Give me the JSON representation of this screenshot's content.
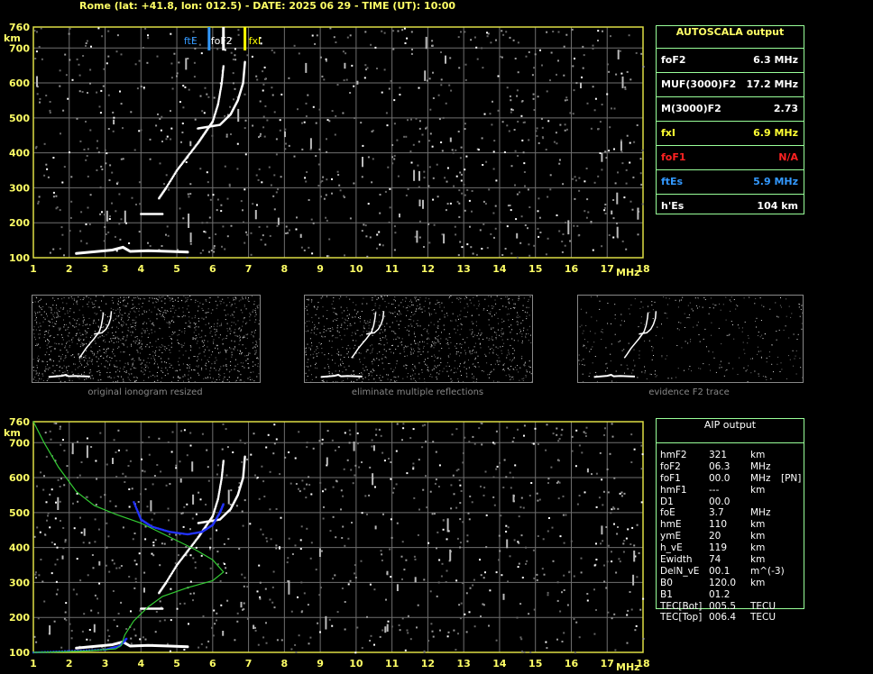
{
  "header": "Rome (lat: +41.8, lon: 012.5) - DATE: 2025 06 29 - TIME (UT): 10:00",
  "chart_data": [
    {
      "type": "scatter",
      "name": "ionogram-autoscala",
      "x_ticks": [
        "1",
        "2",
        "3",
        "4",
        "5",
        "6",
        "7",
        "8",
        "9",
        "10",
        "11",
        "12",
        "13",
        "14",
        "15",
        "16",
        "17",
        "18"
      ],
      "y_ticks": [
        "760",
        "700",
        "600",
        "500",
        "400",
        "300",
        "200",
        "100"
      ],
      "xlabel": "MHz",
      "ylabel": "km",
      "xlim": [
        1,
        18
      ],
      "ylim": [
        100,
        760
      ],
      "markers": [
        {
          "label": "ftE",
          "x": 5.9,
          "color": "#3399ff"
        },
        {
          "label": "foF2",
          "x": 6.3,
          "color": "#ffffff"
        },
        {
          "label": "fxI",
          "x": 6.9,
          "color": "#ffff00"
        }
      ],
      "traces": {
        "e_layer": [
          [
            2.2,
            112
          ],
          [
            2.8,
            118
          ],
          [
            3.2,
            122
          ],
          [
            3.5,
            130
          ],
          [
            3.7,
            118
          ],
          [
            4.2,
            120
          ],
          [
            4.8,
            118
          ],
          [
            5.3,
            116
          ]
        ],
        "es_layer": [
          [
            4.0,
            225
          ],
          [
            4.6,
            225
          ]
        ],
        "f_o_trace": [
          [
            4.5,
            270
          ],
          [
            4.7,
            300
          ],
          [
            5.0,
            350
          ],
          [
            5.3,
            390
          ],
          [
            5.6,
            430
          ],
          [
            5.8,
            460
          ],
          [
            6.0,
            490
          ],
          [
            6.15,
            540
          ],
          [
            6.25,
            600
          ],
          [
            6.3,
            650
          ]
        ],
        "f_x_trace": [
          [
            5.6,
            470
          ],
          [
            6.2,
            480
          ],
          [
            6.5,
            510
          ],
          [
            6.7,
            550
          ],
          [
            6.85,
            600
          ],
          [
            6.9,
            660
          ]
        ]
      }
    },
    {
      "type": "line",
      "name": "ionogram-aip",
      "x_ticks": [
        "1",
        "2",
        "3",
        "4",
        "5",
        "6",
        "7",
        "8",
        "9",
        "10",
        "11",
        "12",
        "13",
        "14",
        "15",
        "16",
        "17",
        "18"
      ],
      "y_ticks": [
        "760",
        "700",
        "600",
        "500",
        "400",
        "300",
        "200",
        "100"
      ],
      "xlabel": "MHz",
      "ylabel": "km",
      "xlim": [
        1,
        18
      ],
      "ylim": [
        100,
        760
      ],
      "profile_green": [
        [
          1.0,
          760
        ],
        [
          1.3,
          700
        ],
        [
          1.7,
          630
        ],
        [
          2.2,
          560
        ],
        [
          2.7,
          520
        ],
        [
          3.3,
          495
        ],
        [
          4.0,
          470
        ],
        [
          4.8,
          430
        ],
        [
          5.5,
          395
        ],
        [
          6.0,
          365
        ],
        [
          6.3,
          330
        ],
        [
          6.0,
          305
        ],
        [
          5.3,
          285
        ],
        [
          4.6,
          260
        ],
        [
          4.2,
          230
        ],
        [
          3.8,
          190
        ],
        [
          3.55,
          150
        ],
        [
          3.45,
          120
        ],
        [
          3.3,
          110
        ],
        [
          2.5,
          104
        ],
        [
          1.5,
          101
        ],
        [
          1.0,
          100
        ]
      ],
      "fit_blue": [
        [
          3.8,
          530
        ],
        [
          4.0,
          480
        ],
        [
          4.3,
          460
        ],
        [
          4.8,
          445
        ],
        [
          5.3,
          438
        ],
        [
          5.7,
          445
        ],
        [
          6.0,
          465
        ],
        [
          6.2,
          500
        ],
        [
          6.3,
          525
        ]
      ],
      "fit_blue_e": [
        [
          1.0,
          100
        ],
        [
          2.0,
          104
        ],
        [
          3.0,
          108
        ],
        [
          3.4,
          118
        ],
        [
          3.6,
          140
        ]
      ]
    }
  ],
  "autoscala": {
    "title": "AUTOSCALA output",
    "rows": [
      {
        "name": "foF2",
        "value": "6.3 MHz",
        "color": "#ffffff"
      },
      {
        "name": "MUF(3000)F2",
        "value": "17.2 MHz",
        "color": "#ffffff"
      },
      {
        "name": "M(3000)F2",
        "value": "2.73",
        "color": "#ffffff"
      },
      {
        "name": "fxI",
        "value": "6.9 MHz",
        "color": "#ffff33"
      },
      {
        "name": "foF1",
        "value": "N/A",
        "color": "#ff2222"
      },
      {
        "name": "ftEs",
        "value": "5.9 MHz",
        "color": "#3399ff"
      },
      {
        "name": "h'Es",
        "value": "104 km",
        "color": "#ffffff"
      }
    ]
  },
  "aip": {
    "title": "AIP output",
    "rows": [
      {
        "name": "hmF2",
        "value": "321",
        "unit": "km"
      },
      {
        "name": "foF2",
        "value": "06.3",
        "unit": "MHz"
      },
      {
        "name": "foF1",
        "value": "00.0",
        "unit": "MHz",
        "extra": "[PN]"
      },
      {
        "name": "hmF1",
        "value": "---",
        "unit": "km"
      },
      {
        "name": "D1",
        "value": "00.0",
        "unit": ""
      },
      {
        "name": "foE",
        "value": "3.7",
        "unit": "MHz"
      },
      {
        "name": "hmE",
        "value": "110",
        "unit": "km"
      },
      {
        "name": "ymE",
        "value": "20",
        "unit": "km"
      },
      {
        "name": "h_vE",
        "value": "119",
        "unit": "km"
      },
      {
        "name": "Ewidth",
        "value": "74",
        "unit": "km"
      },
      {
        "name": "DelN_vE",
        "value": "00.1",
        "unit": "m^(-3)"
      },
      {
        "name": "B0",
        "value": "120.0",
        "unit": "km"
      },
      {
        "name": "B1",
        "value": "01.2",
        "unit": ""
      },
      {
        "name": "TEC[Bot]",
        "value": "005.5",
        "unit": "TECU"
      },
      {
        "name": "TEC[Top]",
        "value": "006.4",
        "unit": "TECU"
      }
    ]
  },
  "thumbnails": [
    {
      "caption": "original ionogram resized"
    },
    {
      "caption": "eliminate multiple reflections"
    },
    {
      "caption": "evidence F2 trace"
    }
  ]
}
